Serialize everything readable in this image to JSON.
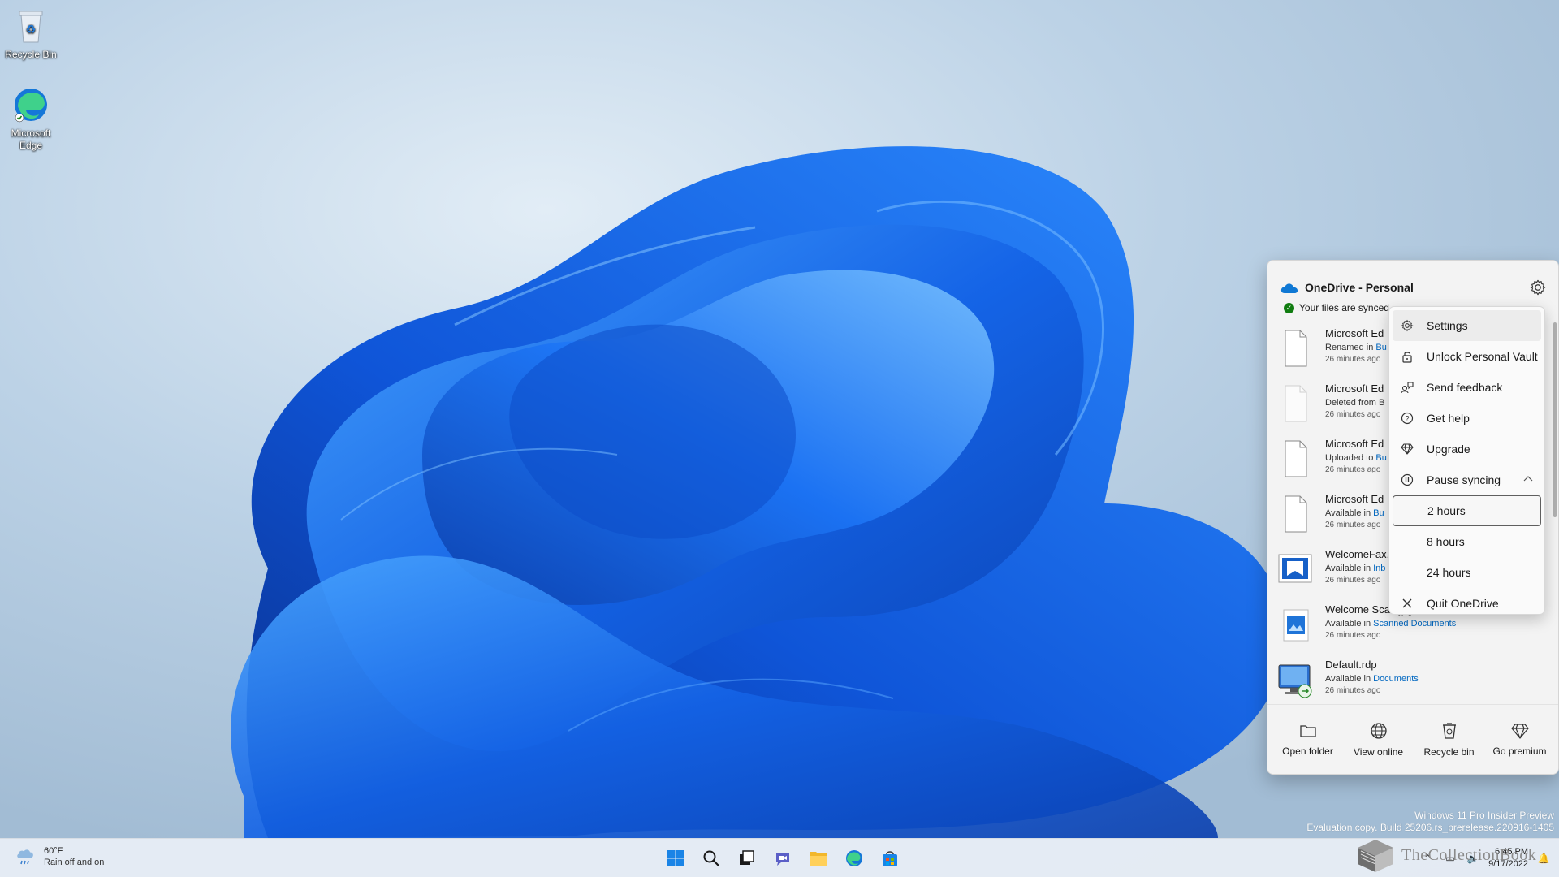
{
  "desktop": {
    "icons": [
      {
        "label": "Recycle Bin"
      },
      {
        "label": "Microsoft Edge"
      }
    ],
    "watermark": {
      "line1": "Windows 11 Pro Insider Preview",
      "line2": "Evaluation copy. Build 25206.rs_prerelease.220916-1405"
    }
  },
  "onedrive": {
    "title": "OneDrive - Personal",
    "status": "Your files are synced",
    "files": [
      {
        "name": "Microsoft Ed",
        "action": "Renamed in ",
        "location": "Bu",
        "time": "26 minutes ago",
        "icon": "document-icon"
      },
      {
        "name": "Microsoft Ed",
        "action": "Deleted from B",
        "location": "",
        "time": "26 minutes ago",
        "icon": "document-faded-icon"
      },
      {
        "name": "Microsoft Ed",
        "action": "Uploaded to ",
        "location": "Bu",
        "time": "26 minutes ago",
        "icon": "document-icon"
      },
      {
        "name": "Microsoft Ed",
        "action": "Available in ",
        "location": "Bu",
        "time": "26 minutes ago",
        "icon": "document-icon"
      },
      {
        "name": "WelcomeFax.",
        "action": "Available in ",
        "location": "Inb",
        "time": "26 minutes ago",
        "icon": "image-icon"
      },
      {
        "name": "Welcome Sca...jpg",
        "action": "Available in ",
        "location": "Scanned Documents",
        "time": "26 minutes ago",
        "icon": "image-icon"
      },
      {
        "name": "Default.rdp",
        "action": "Available in ",
        "location": "Documents",
        "time": "26 minutes ago",
        "icon": "remote-desktop-icon"
      }
    ],
    "footer": [
      {
        "label": "Open folder",
        "icon": "folder-icon"
      },
      {
        "label": "View online",
        "icon": "globe-icon"
      },
      {
        "label": "Recycle bin",
        "icon": "recycle-bin-icon"
      },
      {
        "label": "Go premium",
        "icon": "diamond-icon"
      }
    ]
  },
  "menu": {
    "items": [
      {
        "label": "Settings",
        "icon": "gear-icon"
      },
      {
        "label": "Unlock Personal Vault",
        "icon": "lock-icon"
      },
      {
        "label": "Send feedback",
        "icon": "feedback-icon"
      },
      {
        "label": "Get help",
        "icon": "help-icon"
      },
      {
        "label": "Upgrade",
        "icon": "diamond-icon"
      },
      {
        "label": "Pause syncing",
        "icon": "pause-icon"
      }
    ],
    "pause_options": [
      "2 hours",
      "8 hours",
      "24 hours"
    ],
    "quit": "Quit OneDrive"
  },
  "taskbar": {
    "weather_temp": "60°F",
    "weather_cond": "Rain off and on",
    "time": "6:45 PM",
    "date": "9/17/2022",
    "brand": "TheCollectionBook"
  },
  "colors": {
    "accent": "#0067c0",
    "synced": "#107c10",
    "wallpaper_blue": "#1a6cf0"
  }
}
